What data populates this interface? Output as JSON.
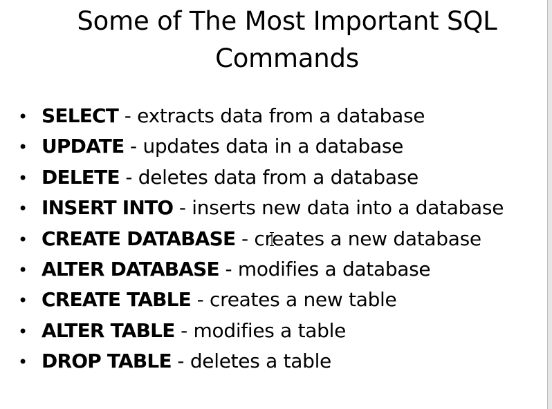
{
  "slide": {
    "title_line1": "Some of The Most Important SQL",
    "title_line2": "Commands",
    "bullet_symbol": "•",
    "separator": " - ",
    "bullets": [
      {
        "command": "SELECT",
        "description": "extracts data from a database"
      },
      {
        "command": "UPDATE",
        "description": "updates data in a database"
      },
      {
        "command": "DELETE",
        "description": "deletes data from a database"
      },
      {
        "command": "INSERT INTO",
        "description": "inserts new data into a database"
      },
      {
        "command": "CREATE DATABASE",
        "description": "creates a new database"
      },
      {
        "command": "ALTER DATABASE",
        "description": "modifies a database"
      },
      {
        "command": "CREATE TABLE",
        "description": "creates a new table"
      },
      {
        "command": "ALTER TABLE",
        "description": "modifies a table"
      },
      {
        "command": "DROP TABLE",
        "description": "deletes a table"
      }
    ]
  },
  "colors": {
    "background": "#ffffff",
    "text": "#000000"
  },
  "icons": {
    "cursor": "text-cursor-icon"
  }
}
